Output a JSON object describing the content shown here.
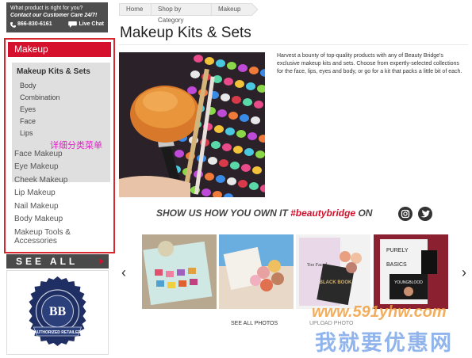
{
  "contact": {
    "question": "What product is right for you?",
    "care": "Contact our Customer Care 24/7!",
    "phone": "866-830-6161",
    "chat": "Live Chat"
  },
  "sidebar": {
    "header": "Makeup",
    "sub_title": "Makeup Kits & Sets",
    "sub_items": [
      "Body",
      "Combination",
      "Eyes",
      "Face",
      "Lips"
    ],
    "annotation": "详细分类菜单",
    "categories": [
      "Face Makeup",
      "Eye Makeup",
      "Cheek Makeup",
      "Lip Makeup",
      "Nail Makeup",
      "Body Makeup",
      "Makeup Tools &",
      "Accessories"
    ]
  },
  "see_all": "SEE ALL",
  "seal": {
    "ring_text": "AUTHENTICITY GUARANTEED",
    "monogram": "BB",
    "ribbon": "AUTHORIZED RETAILER"
  },
  "breadcrumb": [
    "Home",
    "Shop by Category",
    "Makeup"
  ],
  "page_title": "Makeup Kits & Sets",
  "description": "Harvest a bounty of top-quality products with any of Beauty Bridge's exclusive makeup kits and sets. Choose from expertly-selected collections for the face, lips, eyes and body, or go for a kit that packs a little bit of each.",
  "social": {
    "show_prefix": "SHOW US HOW YOU OWN IT ",
    "hashtag": "#beautybridge",
    "on": " ON",
    "icons": [
      "instagram-icon",
      "twitter-icon"
    ]
  },
  "gallery": {
    "see_all_photos": "SEE ALL PHOTOS",
    "upload_photo": "UPLOAD PHOTO",
    "thumb_texts": {
      "black_book": "BLACK BOOK",
      "purely": "PURELY",
      "basics": "BASICS",
      "youngblood": "YOUNGBLOOD",
      "too_faced": "Too Faced"
    }
  },
  "watermark": {
    "url": "www.591yhw.com",
    "slogan": "我就要优惠网"
  },
  "colors": {
    "brand_red": "#d4102c",
    "dark_gray": "#4a4a4a",
    "hashtag": "#d4102c",
    "annotation": "#e020c8"
  }
}
